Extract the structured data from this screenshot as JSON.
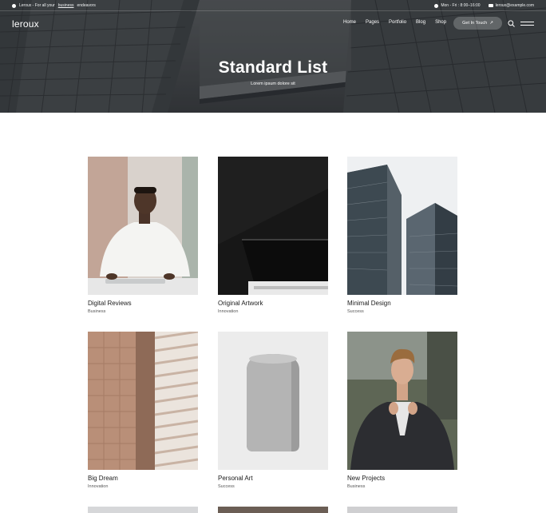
{
  "topbar": {
    "tagline_prefix": "Leroux - For all your",
    "tagline_link": "business",
    "tagline_suffix": "endeavors",
    "hours": "Mon - Fri : 8:00–16:00",
    "email": "leroux@example.com"
  },
  "header": {
    "logo": "leroux",
    "nav": [
      "Home",
      "Pages",
      "Portfolio",
      "Blog",
      "Shop"
    ],
    "cta_label": "Get In Touch",
    "cta_arrow": "↗"
  },
  "hero": {
    "title": "Standard List",
    "subtitle": "Lorem ipsum dolore sit"
  },
  "portfolio": {
    "items": [
      {
        "title": "Digital Reviews",
        "category": "Business"
      },
      {
        "title": "Original Artwork",
        "category": "Innovation"
      },
      {
        "title": "Minimal Design",
        "category": "Success"
      },
      {
        "title": "Big Dream",
        "category": "Innovation"
      },
      {
        "title": "Personal Art",
        "category": "Success"
      },
      {
        "title": "New Projects",
        "category": "Business"
      }
    ]
  },
  "colors": {
    "hero_overlay": "#4d5154",
    "text_primary": "#1b1b1b",
    "text_muted": "#555555"
  }
}
